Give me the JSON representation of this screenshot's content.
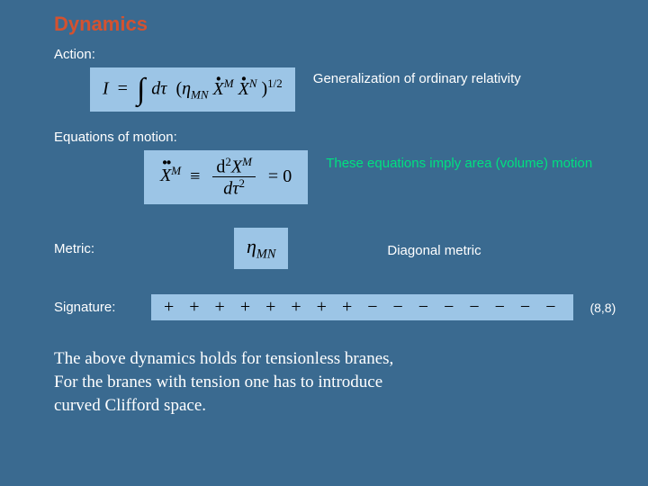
{
  "title": "Dynamics",
  "sections": {
    "action": {
      "label": "Action:",
      "caption": "Generalization of ordinary relativity"
    },
    "eom": {
      "label": "Equations of motion:",
      "caption": "These equations imply area (volume) motion"
    },
    "metric": {
      "label": "Metric:",
      "caption": "Diagonal metric",
      "symbol_eta": "η",
      "symbol_sub": "MN"
    },
    "signature": {
      "label": "Signature:",
      "symbols": "+  +  +  +  +  +  + + −  −  −  −  −  −  −  −",
      "value": "(8,8)"
    }
  },
  "paragraph": {
    "line1": "The above dynamics holds for tensionless branes,",
    "line2": "For the branes with tension one has to introduce",
    "line3": "curved Clifford space."
  },
  "math": {
    "I": "I",
    "eq": "=",
    "dtau": "dτ",
    "eta": "η",
    "MN": "MN",
    "X": "X",
    "M": "M",
    "N": "N",
    "half": "1/2",
    "equiv": "≡",
    "d2": "d",
    "two": "2",
    "zero": "0",
    "open": "(",
    "close": ")"
  }
}
